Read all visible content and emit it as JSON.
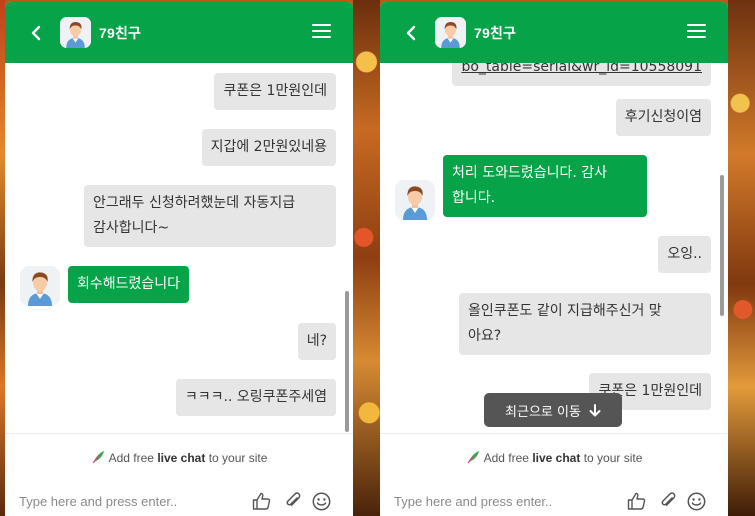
{
  "header": {
    "title": "79친구"
  },
  "footer": {
    "promo_prefix": "Add free",
    "promo_bold": "live chat",
    "promo_suffix": "to your site",
    "input_placeholder": "Type here and press enter.."
  },
  "left_chat": {
    "messages": [
      {
        "side": "out",
        "text": "쿠폰은 1만원인데"
      },
      {
        "side": "out",
        "text": "지갑에 2만원있네용"
      },
      {
        "side": "out",
        "line1": "안그래두 신청하려했눈데 자동지급",
        "line2": "감사합니다~"
      },
      {
        "side": "in",
        "text": "회수해드렸습니다"
      },
      {
        "side": "out",
        "text": "네?"
      },
      {
        "side": "out",
        "text": "ㅋㅋㅋ.. 오링쿠폰주세염"
      }
    ]
  },
  "right_chat": {
    "messages": [
      {
        "side": "out",
        "text": "bo_table=serial&wr_id=10558091"
      },
      {
        "side": "out",
        "text": "후기신청이염"
      },
      {
        "side": "in",
        "line1": "처리 도와드렸습니다. 감사",
        "line2": "합니다."
      },
      {
        "side": "out",
        "text": "오잉.."
      },
      {
        "side": "out",
        "line1": "올인쿠폰도 같이 지급해주신거 맞",
        "line2": "아요?"
      },
      {
        "side": "out",
        "text": "쿠폰은 1만원인데"
      }
    ],
    "jump_label": "최근으로 이동"
  },
  "icons": {
    "back": "back-arrow-icon",
    "menu": "hamburger-menu-icon",
    "promo": "feather-icon",
    "like": "thumbs-up-icon",
    "attach": "paperclip-icon",
    "emoji": "smiley-icon",
    "jump": "arrow-down-icon"
  },
  "colors": {
    "brand": "#06a349",
    "bubble_out": "#e6e6e6",
    "jump_button": "#555555"
  }
}
